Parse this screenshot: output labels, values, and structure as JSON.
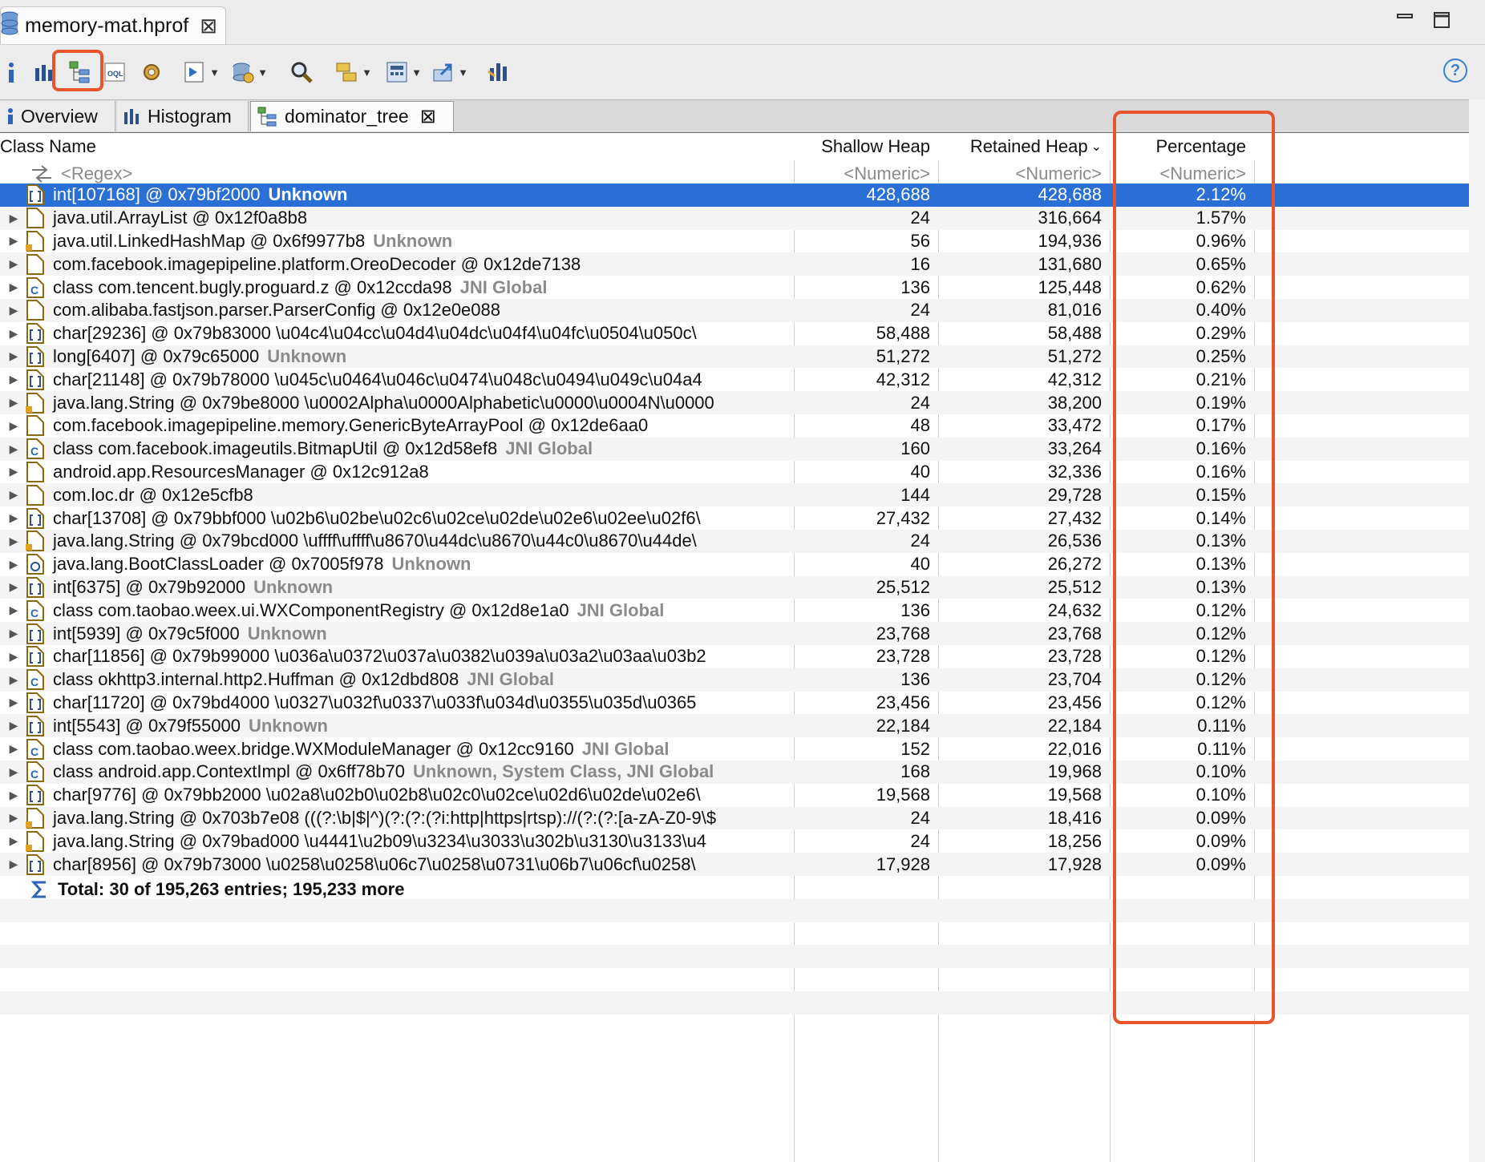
{
  "editor": {
    "file_tab_label": "memory-mat.hprof"
  },
  "view_tabs": [
    {
      "label": "Overview"
    },
    {
      "label": "Histogram"
    },
    {
      "label": "dominator_tree"
    }
  ],
  "help_label": "?",
  "table": {
    "headers": {
      "class_name": "Class Name",
      "shallow_heap": "Shallow Heap",
      "retained_heap": "Retained Heap",
      "percentage": "Percentage"
    },
    "filters": {
      "class_name": "<Regex>",
      "shallow_heap": "<Numeric>",
      "retained_heap": "<Numeric>",
      "percentage": "<Numeric>"
    },
    "rows": [
      {
        "name": "int[107168] @ 0x79bf2000",
        "extra": "Unknown",
        "icon": "array-icon",
        "shallow": "428,688",
        "retained": "428,688",
        "pct": "2.12%"
      },
      {
        "name": "java.util.ArrayList @ 0x12f0a8b8",
        "extra": "",
        "icon": "object-icon",
        "shallow": "24",
        "retained": "316,664",
        "pct": "1.57%"
      },
      {
        "name": "java.util.LinkedHashMap @ 0x6f9977b8",
        "extra": "Unknown",
        "icon": "object-gc-icon",
        "shallow": "56",
        "retained": "194,936",
        "pct": "0.96%"
      },
      {
        "name": "com.facebook.imagepipeline.platform.OreoDecoder @ 0x12de7138",
        "extra": "",
        "icon": "object-icon",
        "shallow": "16",
        "retained": "131,680",
        "pct": "0.65%"
      },
      {
        "name": "class com.tencent.bugly.proguard.z @ 0x12ccda98",
        "extra": "JNI Global",
        "icon": "class-icon",
        "shallow": "136",
        "retained": "125,448",
        "pct": "0.62%"
      },
      {
        "name": "com.alibaba.fastjson.parser.ParserConfig @ 0x12e0e088",
        "extra": "",
        "icon": "object-icon",
        "shallow": "24",
        "retained": "81,016",
        "pct": "0.40%"
      },
      {
        "name": "char[29236] @ 0x79b83000  \\u04c4\\u04cc\\u04d4\\u04dc\\u04f4\\u04fc\\u0504\\u050c\\",
        "extra": "",
        "icon": "array-icon",
        "shallow": "58,488",
        "retained": "58,488",
        "pct": "0.29%"
      },
      {
        "name": "long[6407] @ 0x79c65000",
        "extra": "Unknown",
        "icon": "array-icon",
        "shallow": "51,272",
        "retained": "51,272",
        "pct": "0.25%"
      },
      {
        "name": "char[21148] @ 0x79b78000  \\u045c\\u0464\\u046c\\u0474\\u048c\\u0494\\u049c\\u04a4",
        "extra": "",
        "icon": "array-icon",
        "shallow": "42,312",
        "retained": "42,312",
        "pct": "0.21%"
      },
      {
        "name": "java.lang.String @ 0x79be8000  \\u0002Alpha\\u0000Alphabetic\\u0000\\u0004N\\u0000",
        "extra": "",
        "icon": "object-gc-icon",
        "shallow": "24",
        "retained": "38,200",
        "pct": "0.19%"
      },
      {
        "name": "com.facebook.imagepipeline.memory.GenericByteArrayPool @ 0x12de6aa0",
        "extra": "",
        "icon": "object-icon",
        "shallow": "48",
        "retained": "33,472",
        "pct": "0.17%"
      },
      {
        "name": "class com.facebook.imageutils.BitmapUtil @ 0x12d58ef8",
        "extra": "JNI Global",
        "icon": "class-icon",
        "shallow": "160",
        "retained": "33,264",
        "pct": "0.16%"
      },
      {
        "name": "android.app.ResourcesManager @ 0x12c912a8",
        "extra": "",
        "icon": "object-icon",
        "shallow": "40",
        "retained": "32,336",
        "pct": "0.16%"
      },
      {
        "name": "com.loc.dr @ 0x12e5cfb8",
        "extra": "",
        "icon": "object-icon",
        "shallow": "144",
        "retained": "29,728",
        "pct": "0.15%"
      },
      {
        "name": "char[13708] @ 0x79bbf000  \\u02b6\\u02be\\u02c6\\u02ce\\u02de\\u02e6\\u02ee\\u02f6\\",
        "extra": "",
        "icon": "array-icon",
        "shallow": "27,432",
        "retained": "27,432",
        "pct": "0.14%"
      },
      {
        "name": "java.lang.String @ 0x79bcd000  \\uffff\\uffff\\u8670\\u44dc\\u8670\\u44c0\\u8670\\u44de\\",
        "extra": "",
        "icon": "object-gc-icon",
        "shallow": "24",
        "retained": "26,536",
        "pct": "0.13%"
      },
      {
        "name": "java.lang.BootClassLoader @ 0x7005f978",
        "extra": "Unknown",
        "icon": "loader-icon",
        "shallow": "40",
        "retained": "26,272",
        "pct": "0.13%"
      },
      {
        "name": "int[6375] @ 0x79b92000",
        "extra": "Unknown",
        "icon": "array-icon",
        "shallow": "25,512",
        "retained": "25,512",
        "pct": "0.13%"
      },
      {
        "name": "class com.taobao.weex.ui.WXComponentRegistry @ 0x12d8e1a0",
        "extra": "JNI Global",
        "icon": "class-icon",
        "shallow": "136",
        "retained": "24,632",
        "pct": "0.12%"
      },
      {
        "name": "int[5939] @ 0x79c5f000",
        "extra": "Unknown",
        "icon": "array-icon",
        "shallow": "23,768",
        "retained": "23,768",
        "pct": "0.12%"
      },
      {
        "name": "char[11856] @ 0x79b99000  \\u036a\\u0372\\u037a\\u0382\\u039a\\u03a2\\u03aa\\u03b2",
        "extra": "",
        "icon": "array-icon",
        "shallow": "23,728",
        "retained": "23,728",
        "pct": "0.12%"
      },
      {
        "name": "class okhttp3.internal.http2.Huffman @ 0x12dbd808",
        "extra": "JNI Global",
        "icon": "class-icon",
        "shallow": "136",
        "retained": "23,704",
        "pct": "0.12%"
      },
      {
        "name": "char[11720] @ 0x79bd4000  \\u0327\\u032f\\u0337\\u033f\\u034d\\u0355\\u035d\\u0365",
        "extra": "",
        "icon": "array-icon",
        "shallow": "23,456",
        "retained": "23,456",
        "pct": "0.12%"
      },
      {
        "name": "int[5543] @ 0x79f55000",
        "extra": "Unknown",
        "icon": "array-icon",
        "shallow": "22,184",
        "retained": "22,184",
        "pct": "0.11%"
      },
      {
        "name": "class com.taobao.weex.bridge.WXModuleManager @ 0x12cc9160",
        "extra": "JNI Global",
        "icon": "class-icon",
        "shallow": "152",
        "retained": "22,016",
        "pct": "0.11%"
      },
      {
        "name": "class android.app.ContextImpl @ 0x6ff78b70",
        "extra": "Unknown, System Class, JNI Global",
        "icon": "class-icon",
        "shallow": "168",
        "retained": "19,968",
        "pct": "0.10%"
      },
      {
        "name": "char[9776] @ 0x79bb2000  \\u02a8\\u02b0\\u02b8\\u02c0\\u02ce\\u02d6\\u02de\\u02e6\\",
        "extra": "",
        "icon": "array-icon",
        "shallow": "19,568",
        "retained": "19,568",
        "pct": "0.10%"
      },
      {
        "name": "java.lang.String @ 0x703b7e08  (((?:\\b|$|^)(?:(?:(?i:http|https|rtsp)://(?:(?:[a-zA-Z0-9\\$",
        "extra": "",
        "icon": "object-gc-icon",
        "shallow": "24",
        "retained": "18,416",
        "pct": "0.09%"
      },
      {
        "name": "java.lang.String @ 0x79bad000  \\u4441\\u2b09\\u3234\\u3033\\u302b\\u3130\\u3133\\u4",
        "extra": "",
        "icon": "object-gc-icon",
        "shallow": "24",
        "retained": "18,256",
        "pct": "0.09%"
      },
      {
        "name": "char[8956] @ 0x79b73000  \\u0258\\u0258\\u06c7\\u0258\\u0731\\u06b7\\u06cf\\u0258\\",
        "extra": "",
        "icon": "array-icon",
        "shallow": "17,928",
        "retained": "17,928",
        "pct": "0.09%"
      }
    ],
    "total_label": "Total: 30 of 195,263 entries; 195,233 more"
  },
  "colors": {
    "selection": "#2a6fd6",
    "highlight": "#e8542e"
  }
}
